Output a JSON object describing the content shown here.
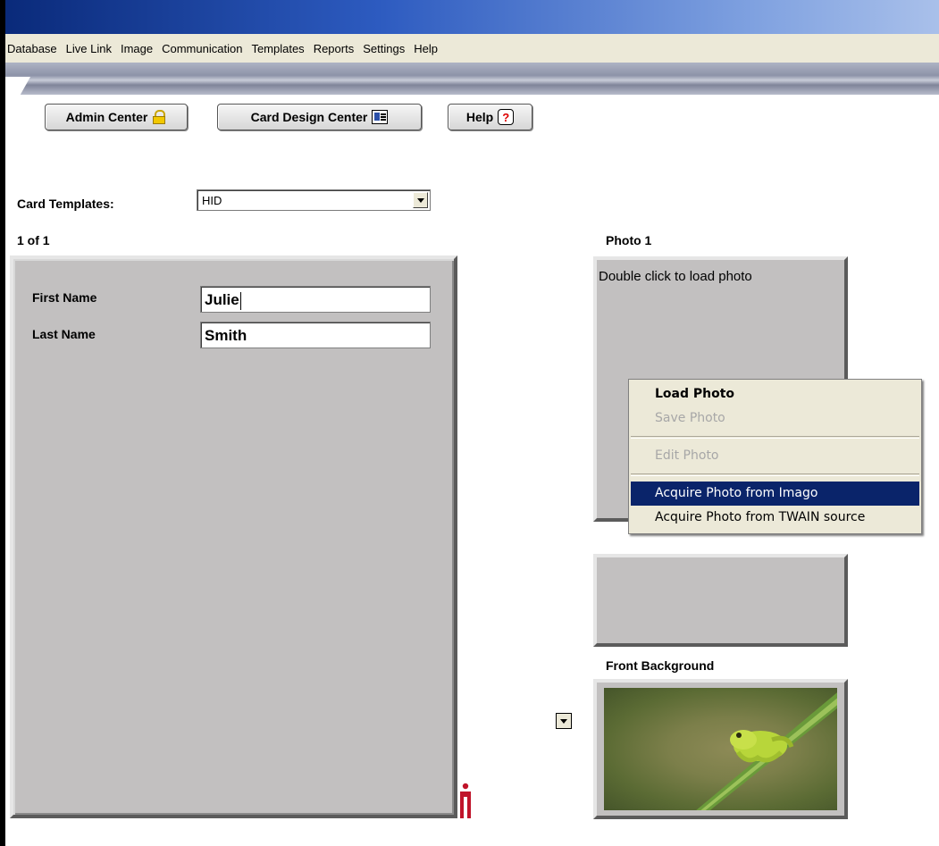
{
  "menubar": {
    "items": [
      "Database",
      "Live Link",
      "Image",
      "Communication",
      "Templates",
      "Reports",
      "Settings",
      "Help"
    ]
  },
  "toolbar": {
    "admin_center": "Admin Center",
    "card_design_center": "Card Design Center",
    "help": "Help",
    "help_icon_glyph": "?"
  },
  "card_templates": {
    "label": "Card Templates:",
    "selected": "HID"
  },
  "record_counter": "1 of 1",
  "fields": [
    {
      "label": "First Name",
      "value": "Julie"
    },
    {
      "label": "Last Name",
      "value": "Smith"
    }
  ],
  "photo": {
    "title": "Photo 1",
    "hint": "Double click to load photo"
  },
  "context_menu": {
    "items": [
      {
        "label": "Load Photo",
        "state": "bold"
      },
      {
        "label": "Save Photo",
        "state": "disabled"
      },
      {
        "label": "Edit Photo",
        "state": "disabled"
      },
      {
        "label": "Acquire Photo from Imago",
        "state": "selected"
      },
      {
        "label": "Acquire Photo from TWAIN source",
        "state": "normal"
      }
    ]
  },
  "front_background": {
    "title": "Front Background"
  },
  "colors": {
    "menu_highlight": "#0a246a",
    "panel_gray": "#c2c0c0",
    "menubar_bg": "#ece9d8"
  }
}
